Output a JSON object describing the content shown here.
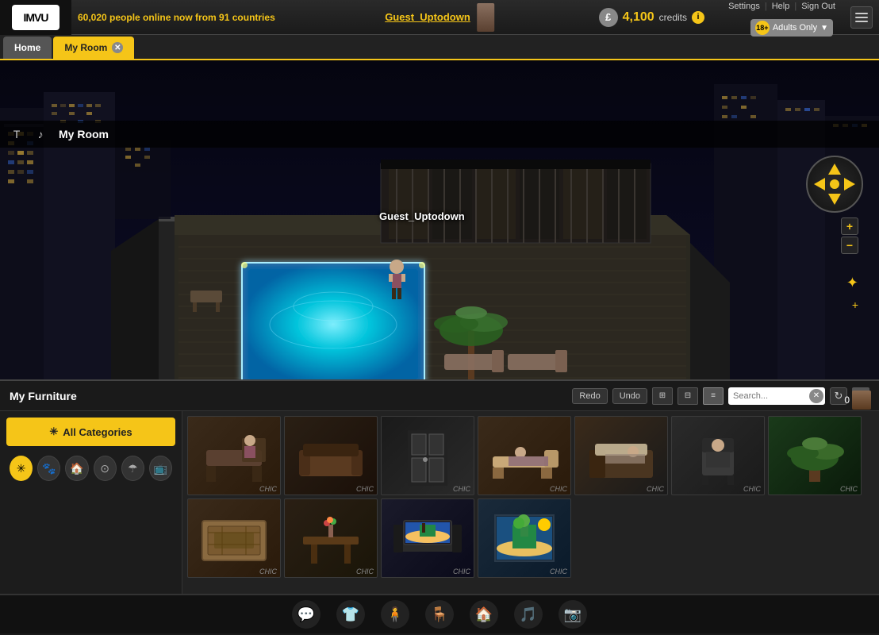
{
  "topbar": {
    "online_count": "60,020",
    "online_text": "people online now from 91 countries",
    "username": "Guest_Uptodown",
    "credits": "4,100",
    "credits_label": "credits",
    "settings": "Settings",
    "help": "Help",
    "sign_out": "Sign Out",
    "age_badge": "18+",
    "adults_only": "Adults Only"
  },
  "tabs": {
    "home": "Home",
    "my_room": "My Room"
  },
  "room_toolbar": {
    "title": "My Room",
    "text_tool": "T",
    "music_tool": "♪"
  },
  "room": {
    "guest_label": "Guest_Uptodown",
    "avatar_count": "0"
  },
  "furniture_panel": {
    "title": "My Furniture",
    "redo": "Redo",
    "undo": "Undo",
    "search_placeholder": "Search...",
    "all_categories": "All Categories",
    "items": [
      {
        "label": "CHIC",
        "type": "bench"
      },
      {
        "label": "CHIC",
        "type": "sofa"
      },
      {
        "label": "CHIC",
        "type": "door"
      },
      {
        "label": "CHIC",
        "type": "lounger"
      },
      {
        "label": "CHIC",
        "type": "bed"
      },
      {
        "label": "CHIC",
        "type": "chair"
      },
      {
        "label": "CHIC",
        "type": "plant"
      },
      {
        "label": "CHIC",
        "type": "rug"
      },
      {
        "label": "CHIC",
        "type": "table"
      },
      {
        "label": "CHIC",
        "type": "tv"
      },
      {
        "label": "CHIC",
        "type": "painting"
      }
    ]
  },
  "bottom_toolbar": {
    "buttons": [
      "💬",
      "👕",
      "🧍",
      "🪑",
      "🏠",
      "🎵",
      "📷"
    ]
  }
}
